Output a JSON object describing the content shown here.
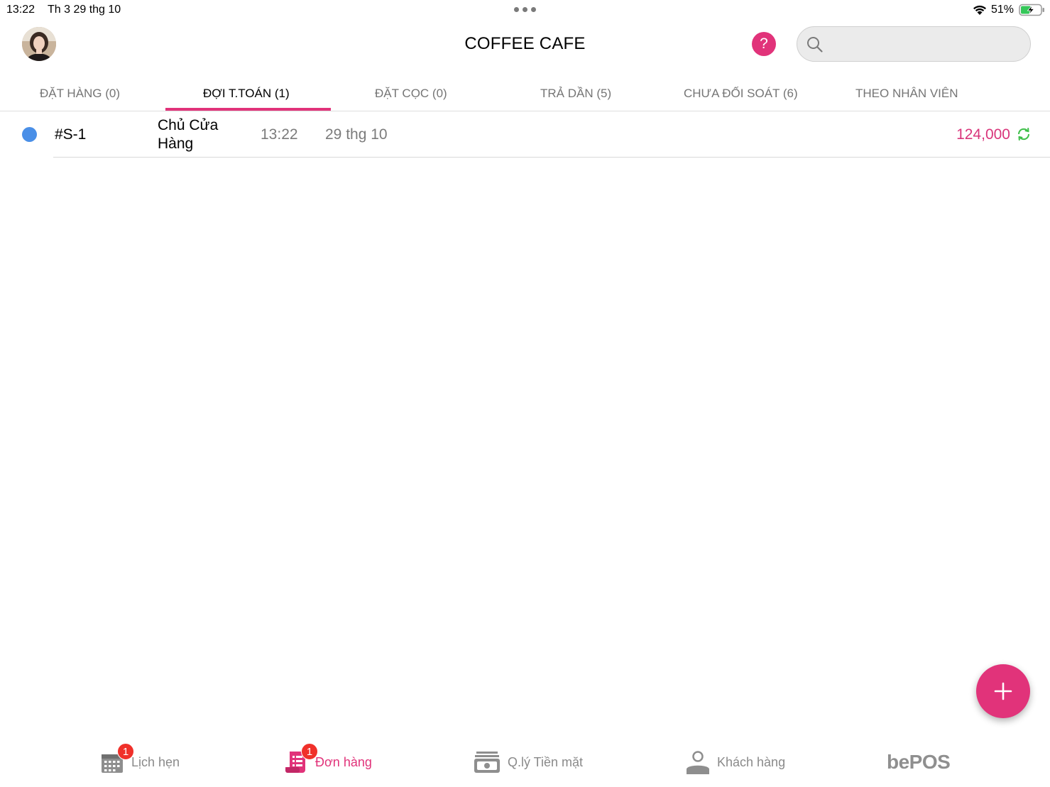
{
  "status_bar": {
    "time": "13:22",
    "date": "Th 3 29 thg 10",
    "battery_percent": "51%",
    "battery_level": 0.51
  },
  "header": {
    "title": "COFFEE CAFE",
    "help_symbol": "?",
    "search_placeholder": ""
  },
  "tabs": [
    {
      "label": "ĐẶT HÀNG (0)",
      "active": false
    },
    {
      "label": "ĐỢI T.TOÁN (1)",
      "active": true
    },
    {
      "label": "ĐẶT CỌC (0)",
      "active": false
    },
    {
      "label": "TRẢ DẦN (5)",
      "active": false
    },
    {
      "label": "CHƯA ĐỐI SOÁT (6)",
      "active": false
    },
    {
      "label": "THEO NHÂN VIÊN",
      "active": false
    }
  ],
  "orders": [
    {
      "id": "#S-1",
      "customer": "Chủ Cửa Hàng",
      "time": "13:22",
      "date": "29 thg 10",
      "amount": "124,000",
      "status_color": "#4a8fe7"
    }
  ],
  "bottom_nav": {
    "items": [
      {
        "label": "Lịch hẹn",
        "icon": "calendar-icon",
        "badge": "1",
        "active": false
      },
      {
        "label": "Đơn hàng",
        "icon": "orders-icon",
        "badge": "1",
        "active": true
      },
      {
        "label": "Q.lý Tiền mặt",
        "icon": "cash-register-icon",
        "badge": "",
        "active": false
      },
      {
        "label": "Khách hàng",
        "icon": "customer-icon",
        "badge": "",
        "active": false
      }
    ],
    "brand": "bePOS"
  },
  "colors": {
    "accent": "#e1337a",
    "status_dot": "#4a8fe7",
    "sync_green": "#3fbf4a",
    "badge_red": "#f0302a"
  }
}
